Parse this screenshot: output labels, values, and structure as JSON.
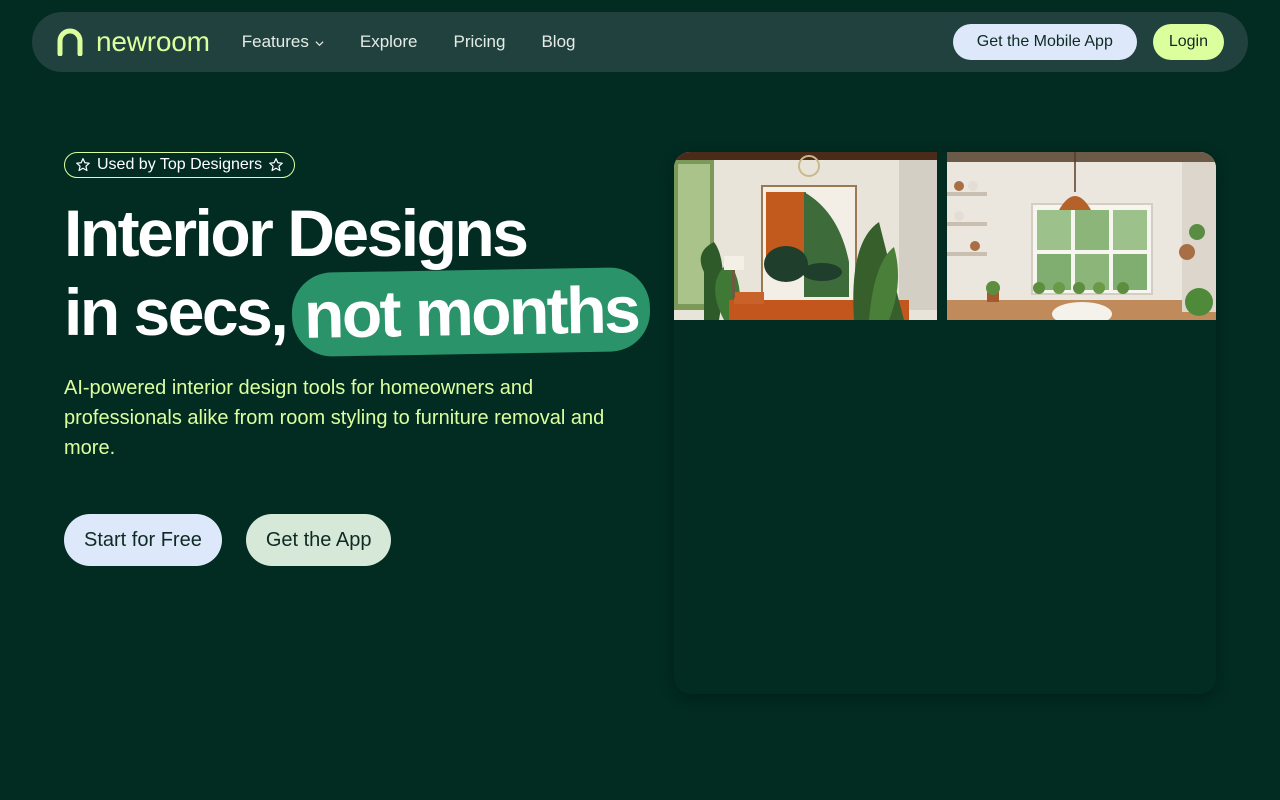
{
  "brand": {
    "name": "newroom"
  },
  "nav": {
    "items": [
      {
        "label": "Features",
        "has_dropdown": true
      },
      {
        "label": "Explore"
      },
      {
        "label": "Pricing"
      },
      {
        "label": "Blog"
      }
    ],
    "mobile_app_label": "Get the Mobile App",
    "login_label": "Login"
  },
  "hero": {
    "badge": "Used by Top Designers",
    "headline_line1": "Interior Designs",
    "headline_line2": "in secs,",
    "headline_highlight": "not months",
    "subtext": "AI-powered interior design tools for homeowners and professionals alike from room styling to furniture removal and more.",
    "cta_primary": "Start for Free",
    "cta_secondary": "Get the App"
  },
  "colors": {
    "background": "#022b22",
    "navbar": "#21413f",
    "accent_lime": "#dcff9e",
    "highlight_green": "#2b936a",
    "button_blue": "#dde9fb",
    "button_mint": "#d6e9d8"
  },
  "icons": {
    "logo": "arch-logo-icon",
    "dropdown": "chevron-down-icon",
    "badge": "star-outline-icon"
  }
}
